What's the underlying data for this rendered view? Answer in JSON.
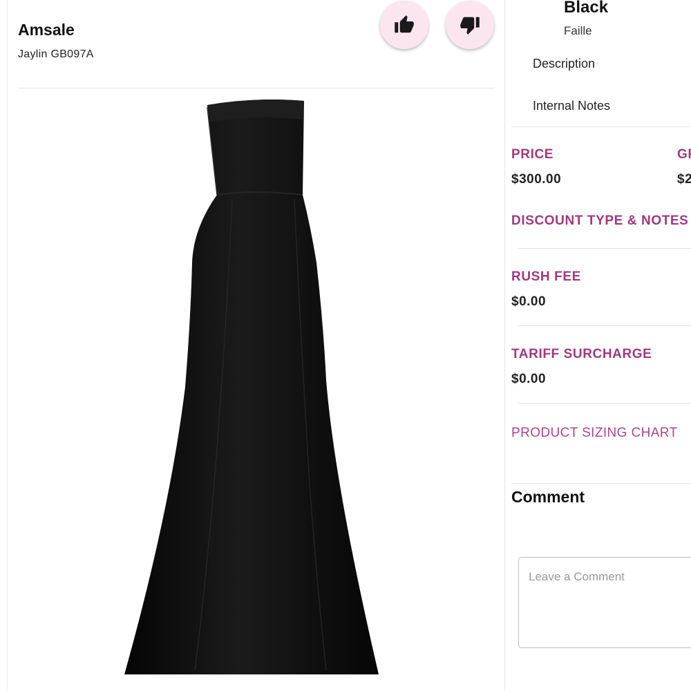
{
  "product": {
    "brand": "Amsale",
    "style_code": "Jaylin GB097A",
    "image_alt": "black strapless gown"
  },
  "actions": {
    "like_icon": "thumbs-up-icon",
    "dislike_icon": "thumbs-down-icon"
  },
  "details": {
    "color": "Black",
    "fabric": "Faille",
    "description_label": "Description",
    "internal_notes_label": "Internal Notes"
  },
  "pricing": {
    "price_label": "PRICE",
    "price_value": "$300.00",
    "clipped_label": "GR",
    "clipped_value": "$2",
    "discount_label": "DISCOUNT TYPE & NOTES",
    "rush_fee_label": "RUSH FEE",
    "rush_fee_value": "$0.00",
    "tariff_label": "TARIFF SURCHARGE",
    "tariff_value": "$0.00",
    "sizing_chart_link": "PRODUCT SIZING CHART"
  },
  "comment": {
    "title": "Comment",
    "placeholder": "Leave a Comment"
  },
  "colors": {
    "accent": "#a3377f",
    "button_bg": "#fbe6f0"
  }
}
